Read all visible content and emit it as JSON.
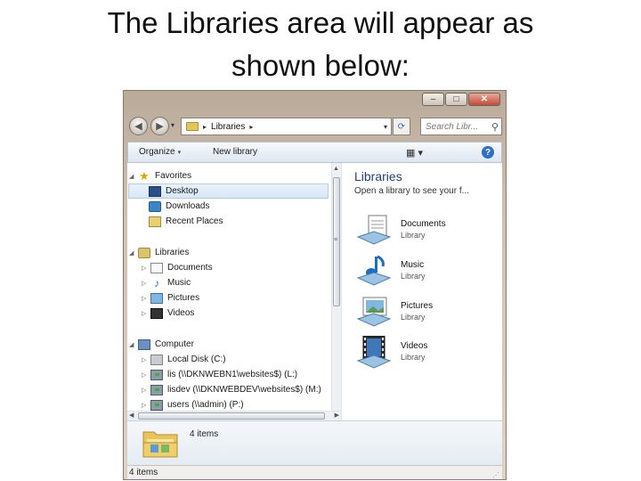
{
  "slide": {
    "title_line1": "The Libraries area will appear as",
    "title_line2": "shown below:"
  },
  "window": {
    "caption_buttons": {
      "minimize": "–",
      "maximize": "□",
      "close": "✕"
    },
    "nav": {
      "back": "◀",
      "forward": "▶",
      "recent_dropdown": "▾"
    },
    "address": {
      "separator": "▸",
      "location": "Libraries",
      "trailing": "▸",
      "dropdown": "▾"
    },
    "refresh": "⟳",
    "search_placeholder": "Search Libr...",
    "search_icon": "⚲",
    "toolbar": {
      "organize": "Organize",
      "new_library": "New library",
      "dropdown_tri": "▾",
      "view_icon": "▦ ▾",
      "help": "?"
    },
    "nav_tree": {
      "favorites": {
        "label": "Favorites",
        "children": [
          "Desktop",
          "Downloads",
          "Recent Places"
        ]
      },
      "libraries": {
        "label": "Libraries",
        "children": [
          "Documents",
          "Music",
          "Pictures",
          "Videos"
        ]
      },
      "computer": {
        "label": "Computer",
        "children": [
          "Local Disk (C:)",
          "lis (\\\\DKNWEBN1\\websites$) (L:)",
          "lisdev (\\\\DKNWEBDEV\\websites$) (M:)",
          "users (\\\\admin) (P:)"
        ]
      }
    },
    "content": {
      "title": "Libraries",
      "subtitle": "Open a library to see your f...",
      "items": [
        {
          "name": "Documents",
          "kind": "Library"
        },
        {
          "name": "Music",
          "kind": "Library"
        },
        {
          "name": "Pictures",
          "kind": "Library"
        },
        {
          "name": "Videos",
          "kind": "Library"
        }
      ]
    },
    "details_pane": {
      "count": "4 items"
    },
    "status_bar": {
      "text": "4 items",
      "gripper": "⋰"
    },
    "colors": {
      "selection": "#d7e7f7",
      "lib_title": "#1e3f73",
      "help_blue": "#2d6fc5"
    }
  }
}
